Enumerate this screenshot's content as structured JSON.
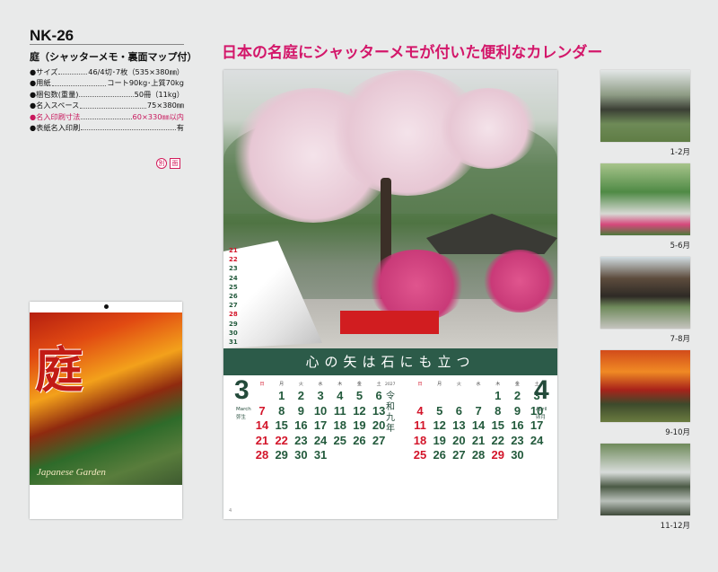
{
  "product": {
    "model": "NK-26",
    "subtitle": "庭（シャッターメモ・裏面マップ付）",
    "specs": [
      {
        "key": "●サイズ",
        "value": "46/4切･7枚（535×380㎜）",
        "highlight": false
      },
      {
        "key": "●用紙",
        "value": "コート90kg･上質70kg",
        "highlight": false
      },
      {
        "key": "●梱包数(重量)",
        "value": "50冊（11kg）",
        "highlight": false
      },
      {
        "key": "●名入スペース",
        "value": "75×380㎜",
        "highlight": false
      },
      {
        "key": "●名入印刷寸法",
        "value": "60×330㎜以内",
        "highlight": true
      },
      {
        "key": "●表紙名入印刷",
        "value": "有",
        "highlight": false
      }
    ],
    "marks": [
      "別",
      "面"
    ],
    "cover": {
      "kanji": "庭",
      "caption": "Japanese Garden"
    }
  },
  "headline": "日本の名庭にシャッターメモが付いた便利なカレンダー",
  "calendar": {
    "motto": "心の矢は石にも立つ",
    "curl_rows": [
      {
        "n": "21",
        "red": true
      },
      {
        "n": "22",
        "red": true
      },
      {
        "n": "23",
        "red": false
      },
      {
        "n": "24",
        "red": false
      },
      {
        "n": "25",
        "red": false
      },
      {
        "n": "26",
        "red": false
      },
      {
        "n": "27",
        "red": false
      },
      {
        "n": "28",
        "red": true
      },
      {
        "n": "29",
        "red": false
      },
      {
        "n": "30",
        "red": false
      },
      {
        "n": "31",
        "red": false
      }
    ],
    "era": "令和九年",
    "year": "2027",
    "page_no": "4",
    "weekdays": [
      "日",
      "月",
      "火",
      "水",
      "木",
      "金",
      "土"
    ],
    "march": {
      "number": "3",
      "en": "March",
      "jp": "弥生",
      "rows": [
        [
          "",
          "1",
          "2",
          "3",
          "4",
          "5",
          "6"
        ],
        [
          "7",
          "8",
          "9",
          "10",
          "11",
          "12",
          "13"
        ],
        [
          "14",
          "15",
          "16",
          "17",
          "18",
          "19",
          "20"
        ],
        [
          "21",
          "22",
          "23",
          "24",
          "25",
          "26",
          "27"
        ],
        [
          "28",
          "29",
          "30",
          "31",
          "",
          "",
          ""
        ]
      ],
      "holidays": [
        "22"
      ]
    },
    "april": {
      "number": "4",
      "en": "April",
      "jp": "卯月",
      "rows": [
        [
          "",
          "",
          "",
          "",
          "1",
          "2",
          "3"
        ],
        [
          "4",
          "5",
          "6",
          "7",
          "8",
          "9",
          "10"
        ],
        [
          "11",
          "12",
          "13",
          "14",
          "15",
          "16",
          "17"
        ],
        [
          "18",
          "19",
          "20",
          "21",
          "22",
          "23",
          "24"
        ],
        [
          "25",
          "26",
          "27",
          "28",
          "29",
          "30",
          ""
        ]
      ],
      "holidays": [
        "29"
      ]
    }
  },
  "thumbnails": [
    {
      "label": "1-2月"
    },
    {
      "label": "5-6月"
    },
    {
      "label": "7-8月"
    },
    {
      "label": "9-10月"
    },
    {
      "label": "11-12月"
    }
  ]
}
